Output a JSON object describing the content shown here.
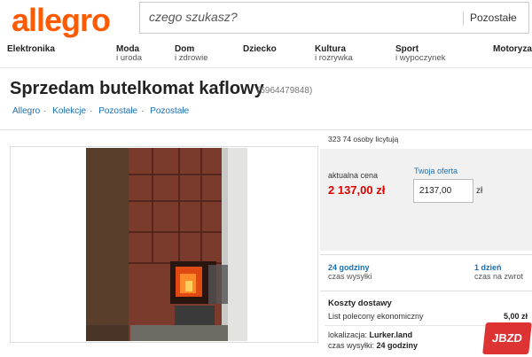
{
  "header": {
    "logo": "allegro",
    "search_placeholder": "czego szukasz?",
    "search_category": "Pozostałe"
  },
  "categories": [
    {
      "name": "Elektronika",
      "sub": ""
    },
    {
      "name": "Moda",
      "sub": "i uroda"
    },
    {
      "name": "Dom",
      "sub": "i zdrowie"
    },
    {
      "name": "Dziecko",
      "sub": ""
    },
    {
      "name": "Kultura",
      "sub": "i rozrywka"
    },
    {
      "name": "Sport",
      "sub": "i wypoczynek"
    },
    {
      "name": "Motoryza",
      "sub": ""
    }
  ],
  "listing": {
    "title": "Sprzedam butelkomat kaflowy",
    "id": "(6964479848)"
  },
  "breadcrumbs": [
    "Allegro",
    "Kolekcje",
    "Pozostałe",
    "Pozostałe"
  ],
  "buy": {
    "watchers": "323 74 osoby licytują",
    "price_label": "aktualna cena",
    "price": "2 137,00 zł",
    "offer_label": "Twoja oferta",
    "offer_value": "2137,00",
    "offer_unit": "zł"
  },
  "shipping": {
    "dispatch_value": "24 godziny",
    "dispatch_label": "czas wysyłki",
    "return_value": "1 dzień",
    "return_label": "czas na zwrot"
  },
  "costs": {
    "title": "Koszty dostawy",
    "method": "List polecony ekonomiczny",
    "method_price": "5,00 zł",
    "location_label": "lokalizacja:",
    "location_value": "Lurker.land",
    "dispatch_label": "czas wysyłki:",
    "dispatch_value": "24 godziny"
  },
  "watermark": "JBZD",
  "colors": {
    "brand": "#ff5a00",
    "price": "#e00000",
    "link": "#1a6fb0"
  }
}
